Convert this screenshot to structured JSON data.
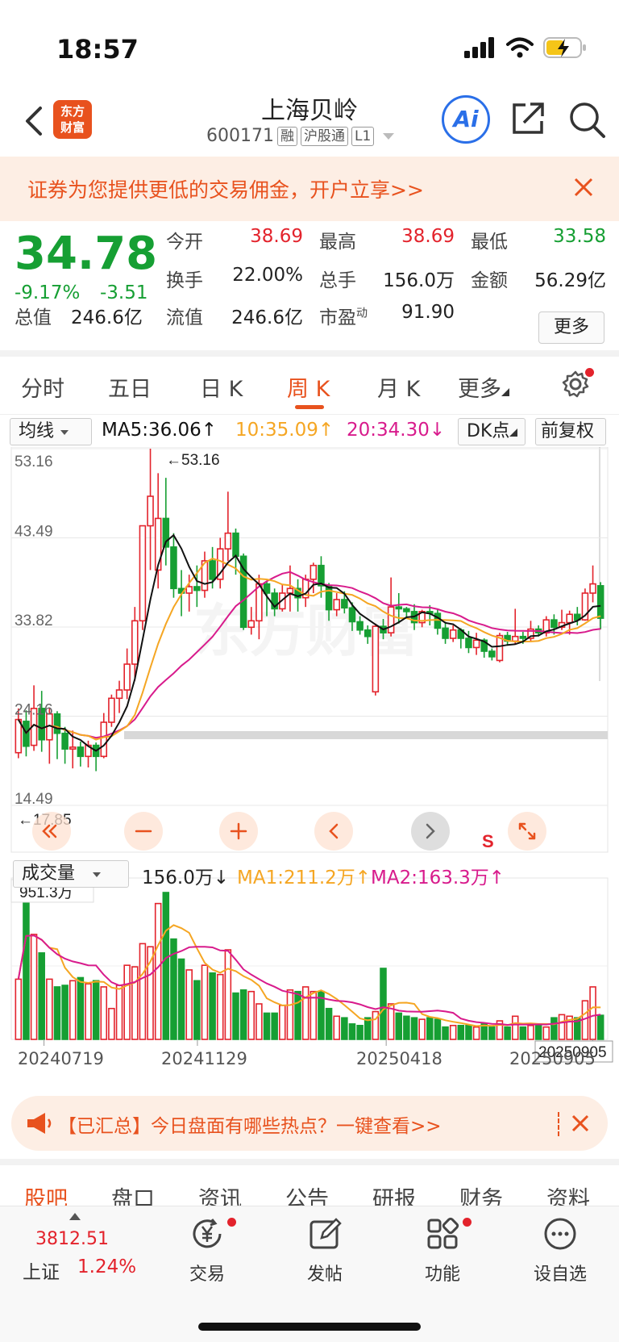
{
  "status_bar": {
    "time": "18:57"
  },
  "header": {
    "back_icon": "chevron-left-icon",
    "logo_text_top": "东方",
    "logo_text_bottom": "财富",
    "stock_name": "上海贝岭",
    "stock_code": "600171",
    "tags": [
      "融",
      "沪股通",
      "L1"
    ],
    "ai_label": "Ai"
  },
  "promo_banner": {
    "text": "证券为您提供更低的交易佣金，开户立享>>"
  },
  "quote": {
    "price": "34.78",
    "change_pct": "-9.17%",
    "change_amt": "-3.51",
    "open_label": "今开",
    "open": "38.69",
    "high_label": "最高",
    "high": "38.69",
    "low_label": "最低",
    "low": "33.58",
    "turnover_label": "换手",
    "turnover": "22.00%",
    "volume_label": "总手",
    "volume": "156.0万",
    "amount_label": "金额",
    "amount": "56.29亿",
    "mktcap_label": "总值",
    "mktcap": "246.6亿",
    "float_label": "流值",
    "float_cap": "246.6亿",
    "pe_label": "市盈",
    "pe_sup": "动",
    "pe": "91.90",
    "more_button": "更多"
  },
  "period_tabs": [
    "分时",
    "五日",
    "日 K",
    "周 K",
    "月 K",
    "更多"
  ],
  "active_period": "周 K",
  "ma_row": {
    "select": "均线",
    "ma5": "MA5:36.06↑",
    "ma10": "10:35.09↑",
    "ma20": "20:34.30↓",
    "dk_button": "DK点",
    "adjust_button": "前复权"
  },
  "price_axis": [
    "53.16",
    "43.49",
    "33.82",
    "24.16",
    "14.49"
  ],
  "price_annotations": {
    "max": "←53.16",
    "min": "←17.85"
  },
  "vol_row": {
    "select": "成交量",
    "vol": "156.0万↓",
    "ma1": "MA1:211.2万↑",
    "ma2": "MA2:163.3万↑",
    "vol_max_label": "951.3万"
  },
  "date_axis": [
    "20240719",
    "20241129",
    "20250418",
    "20250905"
  ],
  "chart_marker": "S",
  "notice": {
    "text": "【已汇总】今日盘面有哪些热点？一键查看>>"
  },
  "sub_tabs": [
    "股吧",
    "盘口",
    "资讯",
    "公告",
    "研报",
    "财务",
    "资料"
  ],
  "bottom_bar": {
    "index_value": "3812.51",
    "index_name": "上证",
    "index_pct": "1.24%",
    "items": [
      "交易",
      "发帖",
      "功能",
      "设自选"
    ]
  },
  "colors": {
    "up": "#e3232c",
    "down": "#169f33",
    "accent": "#e8521e",
    "ma5": "#111111",
    "ma10": "#f5a623",
    "ma20": "#d81b8c"
  },
  "chart_data": {
    "type": "candlestick",
    "period": "weekly",
    "ylim": [
      14.49,
      53.16
    ],
    "price_ticks": [
      53.16,
      43.49,
      33.82,
      24.16,
      14.49
    ],
    "ohlc": [
      [
        20.2,
        23.8,
        19.6,
        25.0
      ],
      [
        23.6,
        20.9,
        19.8,
        24.8
      ],
      [
        21.0,
        25.0,
        20.4,
        27.5
      ],
      [
        25.0,
        21.6,
        20.3,
        26.9
      ],
      [
        21.6,
        24.4,
        19.0,
        25.1
      ],
      [
        24.4,
        22.3,
        19.5,
        24.7
      ],
      [
        22.3,
        20.6,
        19.0,
        23.0
      ],
      [
        20.6,
        20.8,
        18.5,
        22.6
      ],
      [
        20.8,
        19.8,
        18.7,
        21.4
      ],
      [
        19.8,
        21.0,
        18.6,
        21.5
      ],
      [
        21.0,
        19.8,
        18.2,
        21.3
      ],
      [
        19.8,
        23.5,
        19.6,
        24.5
      ],
      [
        23.5,
        26.1,
        23.0,
        26.5
      ],
      [
        26.1,
        27.0,
        24.5,
        28.0
      ],
      [
        27.0,
        29.8,
        26.0,
        31.5
      ],
      [
        29.8,
        34.5,
        28.0,
        36.0
      ],
      [
        34.5,
        44.8,
        33.5,
        44.8
      ],
      [
        44.8,
        48.0,
        40.0,
        53.16
      ],
      [
        40.0,
        45.6,
        38.0,
        50.5
      ],
      [
        45.6,
        42.5,
        40.5,
        50.0
      ],
      [
        42.5,
        38.0,
        37.0,
        44.0
      ],
      [
        38.0,
        37.5,
        35.0,
        40.0
      ],
      [
        37.5,
        38.2,
        35.5,
        39.5
      ],
      [
        38.2,
        37.8,
        36.0,
        40.5
      ],
      [
        37.8,
        41.0,
        37.0,
        42.0
      ],
      [
        41.0,
        39.0,
        38.0,
        42.5
      ],
      [
        39.0,
        42.3,
        38.0,
        43.5
      ],
      [
        42.3,
        44.0,
        41.0,
        48.5
      ],
      [
        44.0,
        41.5,
        39.5,
        44.5
      ],
      [
        41.5,
        33.8,
        33.5,
        41.8
      ],
      [
        33.8,
        34.5,
        33.0,
        36.0
      ],
      [
        34.5,
        38.5,
        32.5,
        39.5
      ],
      [
        38.5,
        37.5,
        35.0,
        38.8
      ],
      [
        37.5,
        35.8,
        35.0,
        38.0
      ],
      [
        35.8,
        37.5,
        35.5,
        38.5
      ],
      [
        37.5,
        38.0,
        35.5,
        40.5
      ],
      [
        38.0,
        37.0,
        35.5,
        39.0
      ],
      [
        37.0,
        39.0,
        36.0,
        39.5
      ],
      [
        39.0,
        40.5,
        37.5,
        40.8
      ],
      [
        40.5,
        38.3,
        37.0,
        41.5
      ],
      [
        38.3,
        35.7,
        34.5,
        38.6
      ],
      [
        35.7,
        36.8,
        35.0,
        37.5
      ],
      [
        36.8,
        35.9,
        35.3,
        37.7
      ],
      [
        35.9,
        34.4,
        33.4,
        36.5
      ],
      [
        34.4,
        33.5,
        33.0,
        35.0
      ],
      [
        33.5,
        32.8,
        32.0,
        34.0
      ],
      [
        26.8,
        33.9,
        26.4,
        34.2
      ],
      [
        33.9,
        33.2,
        32.5,
        34.7
      ],
      [
        33.2,
        36.0,
        32.8,
        39.2
      ],
      [
        36.0,
        35.8,
        34.2,
        37.5
      ],
      [
        35.8,
        35.5,
        34.8,
        36.0
      ],
      [
        35.5,
        34.3,
        33.5,
        36.3
      ],
      [
        34.3,
        35.5,
        33.8,
        35.7
      ],
      [
        35.5,
        35.3,
        34.0,
        36.2
      ],
      [
        35.3,
        33.7,
        33.0,
        35.8
      ],
      [
        33.7,
        32.6,
        32.0,
        34.4
      ],
      [
        32.6,
        33.5,
        32.2,
        34.0
      ],
      [
        33.5,
        32.6,
        31.5,
        33.7
      ],
      [
        32.6,
        31.6,
        31.0,
        33.4
      ],
      [
        31.6,
        32.4,
        30.8,
        33.2
      ],
      [
        32.4,
        31.2,
        30.5,
        32.6
      ],
      [
        31.2,
        30.6,
        30.2,
        31.5
      ],
      [
        30.2,
        32.9,
        30.0,
        33.2
      ],
      [
        32.9,
        32.3,
        31.8,
        33.3
      ],
      [
        32.3,
        32.8,
        32.0,
        35.8
      ],
      [
        32.8,
        32.6,
        32.0,
        33.3
      ],
      [
        32.6,
        33.6,
        32.3,
        34.5
      ],
      [
        33.6,
        33.2,
        32.8,
        34.0
      ],
      [
        33.2,
        34.6,
        32.8,
        35.0
      ],
      [
        34.6,
        33.8,
        33.0,
        35.2
      ],
      [
        33.8,
        34.3,
        33.5,
        35.7
      ],
      [
        34.3,
        35.2,
        33.0,
        35.6
      ],
      [
        35.2,
        34.6,
        34.0,
        36.0
      ],
      [
        34.6,
        37.5,
        34.5,
        38.0
      ],
      [
        37.5,
        38.5,
        36.5,
        40.5
      ],
      [
        38.3,
        34.78,
        33.58,
        38.69
      ]
    ],
    "volume_wan": [
      390,
      950,
      680,
      560,
      390,
      340,
      350,
      380,
      400,
      360,
      380,
      340,
      200,
      350,
      480,
      470,
      620,
      600,
      880,
      951.3,
      650,
      520,
      450,
      380,
      480,
      430,
      420,
      580,
      300,
      320,
      310,
      230,
      170,
      170,
      220,
      320,
      310,
      340,
      310,
      310,
      200,
      150,
      140,
      100,
      90,
      140,
      180,
      460,
      230,
      170,
      150,
      140,
      130,
      140,
      130,
      80,
      90,
      90,
      90,
      80,
      100,
      80,
      120,
      80,
      150,
      80,
      90,
      100,
      80,
      140,
      160,
      150,
      140,
      250,
      340,
      156
    ],
    "volume_max_wan": 951.3,
    "dates": [
      "20240719",
      "20241129",
      "20250418",
      "20250905"
    ]
  }
}
